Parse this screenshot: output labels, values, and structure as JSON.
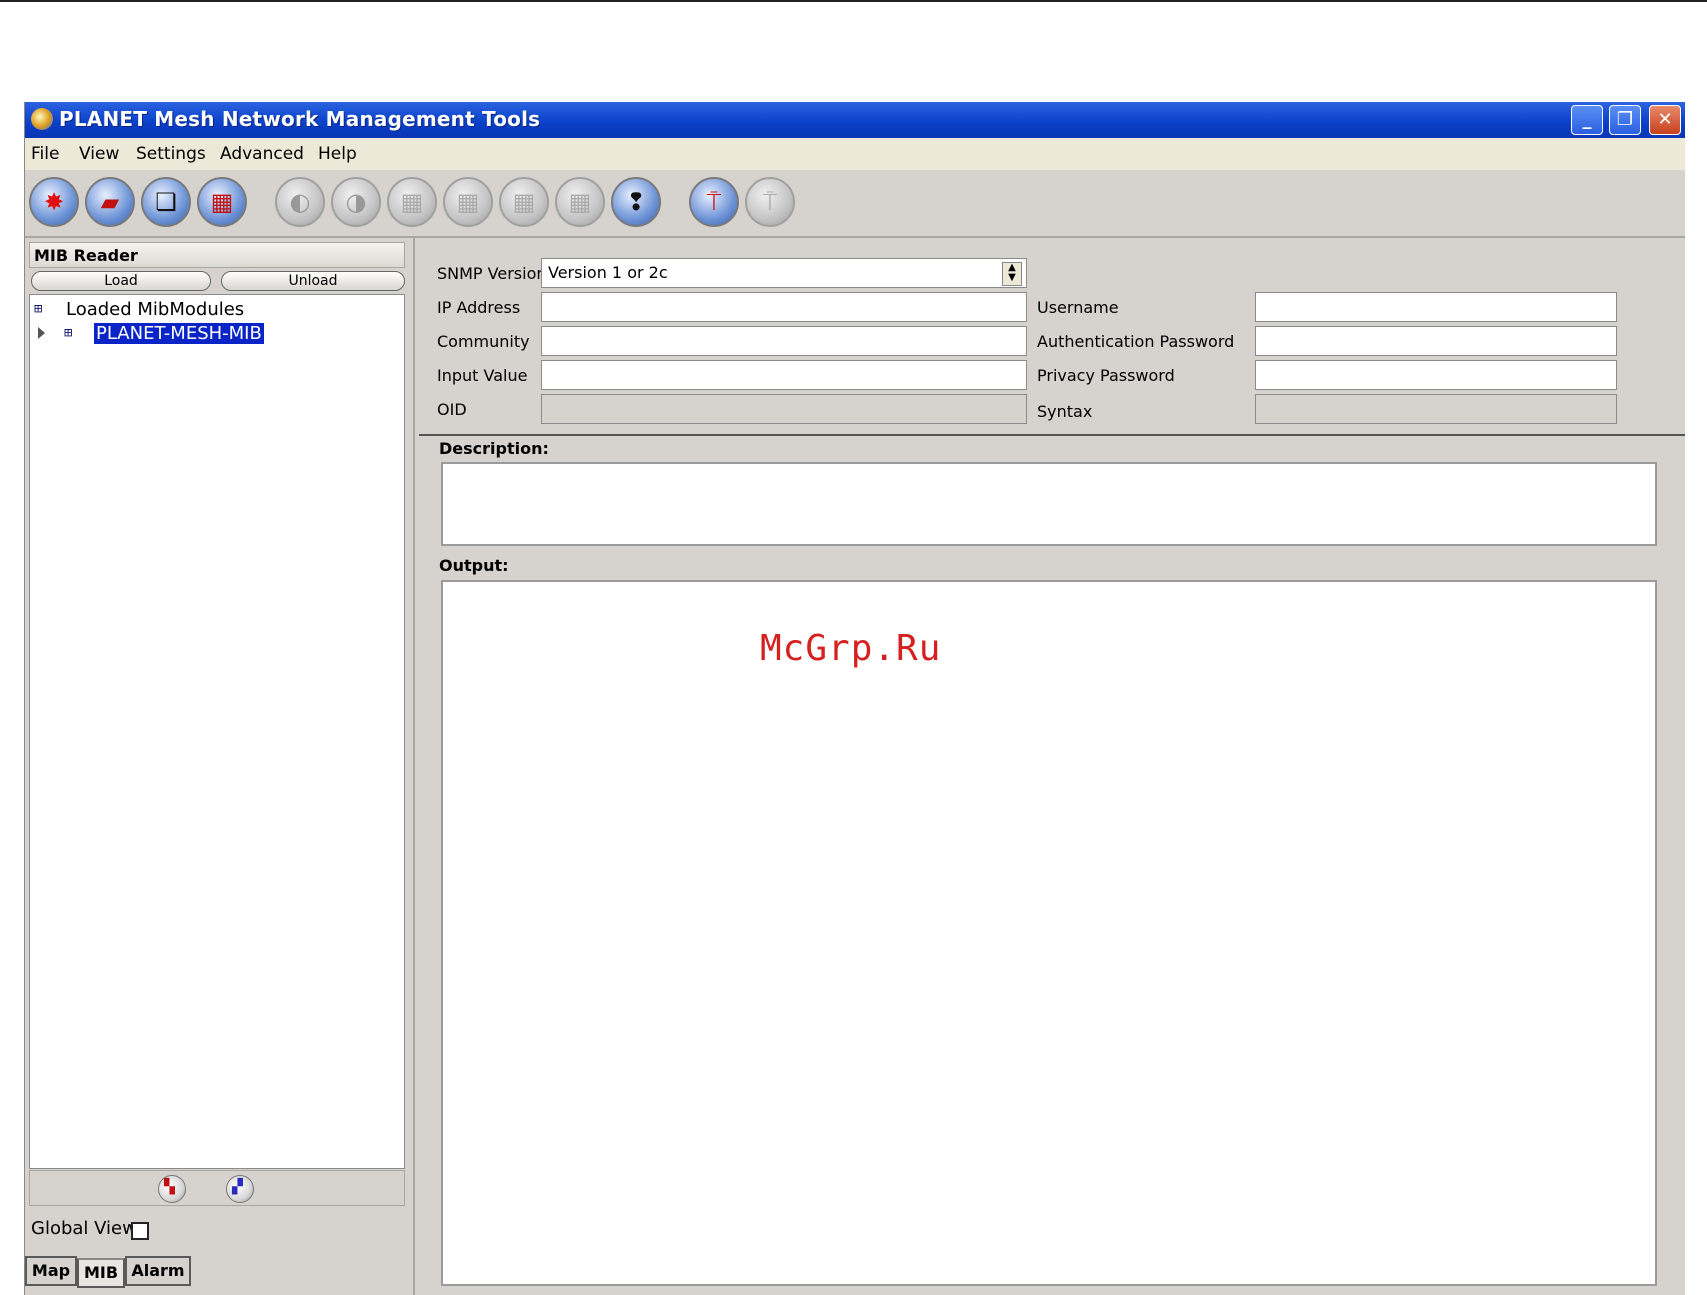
{
  "window": {
    "title": "PLANET Mesh Network Management Tools"
  },
  "menu": [
    "File",
    "View",
    "Settings",
    "Advanced",
    "Help"
  ],
  "toolbar": {
    "buttons": [
      {
        "icon": "alarm-burst-icon",
        "enabled": true
      },
      {
        "icon": "open-folder-icon",
        "enabled": true
      },
      {
        "icon": "windows-stack-icon",
        "enabled": true
      },
      {
        "icon": "grid-squares-icon",
        "enabled": true
      },
      {
        "icon": "swirl-icon",
        "enabled": false
      },
      {
        "icon": "swirl-icon",
        "enabled": false
      },
      {
        "icon": "grid-icon",
        "enabled": false
      },
      {
        "icon": "grid-icon",
        "enabled": false
      },
      {
        "icon": "grid-icon",
        "enabled": false
      },
      {
        "icon": "grid-icon",
        "enabled": false
      },
      {
        "icon": "footprints-icon",
        "enabled": true
      },
      {
        "icon": "wireless-antenna-icon",
        "enabled": true
      },
      {
        "icon": "wireless-antenna-icon",
        "enabled": false
      }
    ]
  },
  "mib_reader": {
    "title": "MIB Reader",
    "load_label": "Load",
    "unload_label": "Unload",
    "tree_root": "Loaded MibModules",
    "tree_selected": "PLANET-MESH-MIB",
    "global_view_label": "Global View",
    "global_view_checked": false
  },
  "tabs": [
    {
      "label": "Map",
      "active": false
    },
    {
      "label": "MIB",
      "active": true
    },
    {
      "label": "Alarm",
      "active": false
    }
  ],
  "form": {
    "snmp_version_label": "SNMP Version",
    "snmp_version_value": "Version 1 or 2c",
    "ip_address_label": "IP Address",
    "community_label": "Community",
    "input_value_label": "Input Value",
    "oid_label": "OID",
    "username_label": "Username",
    "auth_password_label": "Authentication Password",
    "privacy_password_label": "Privacy Password",
    "syntax_label": "Syntax"
  },
  "description_title": "Description:",
  "output_title": "Output:",
  "watermark": "McGrp.Ru"
}
